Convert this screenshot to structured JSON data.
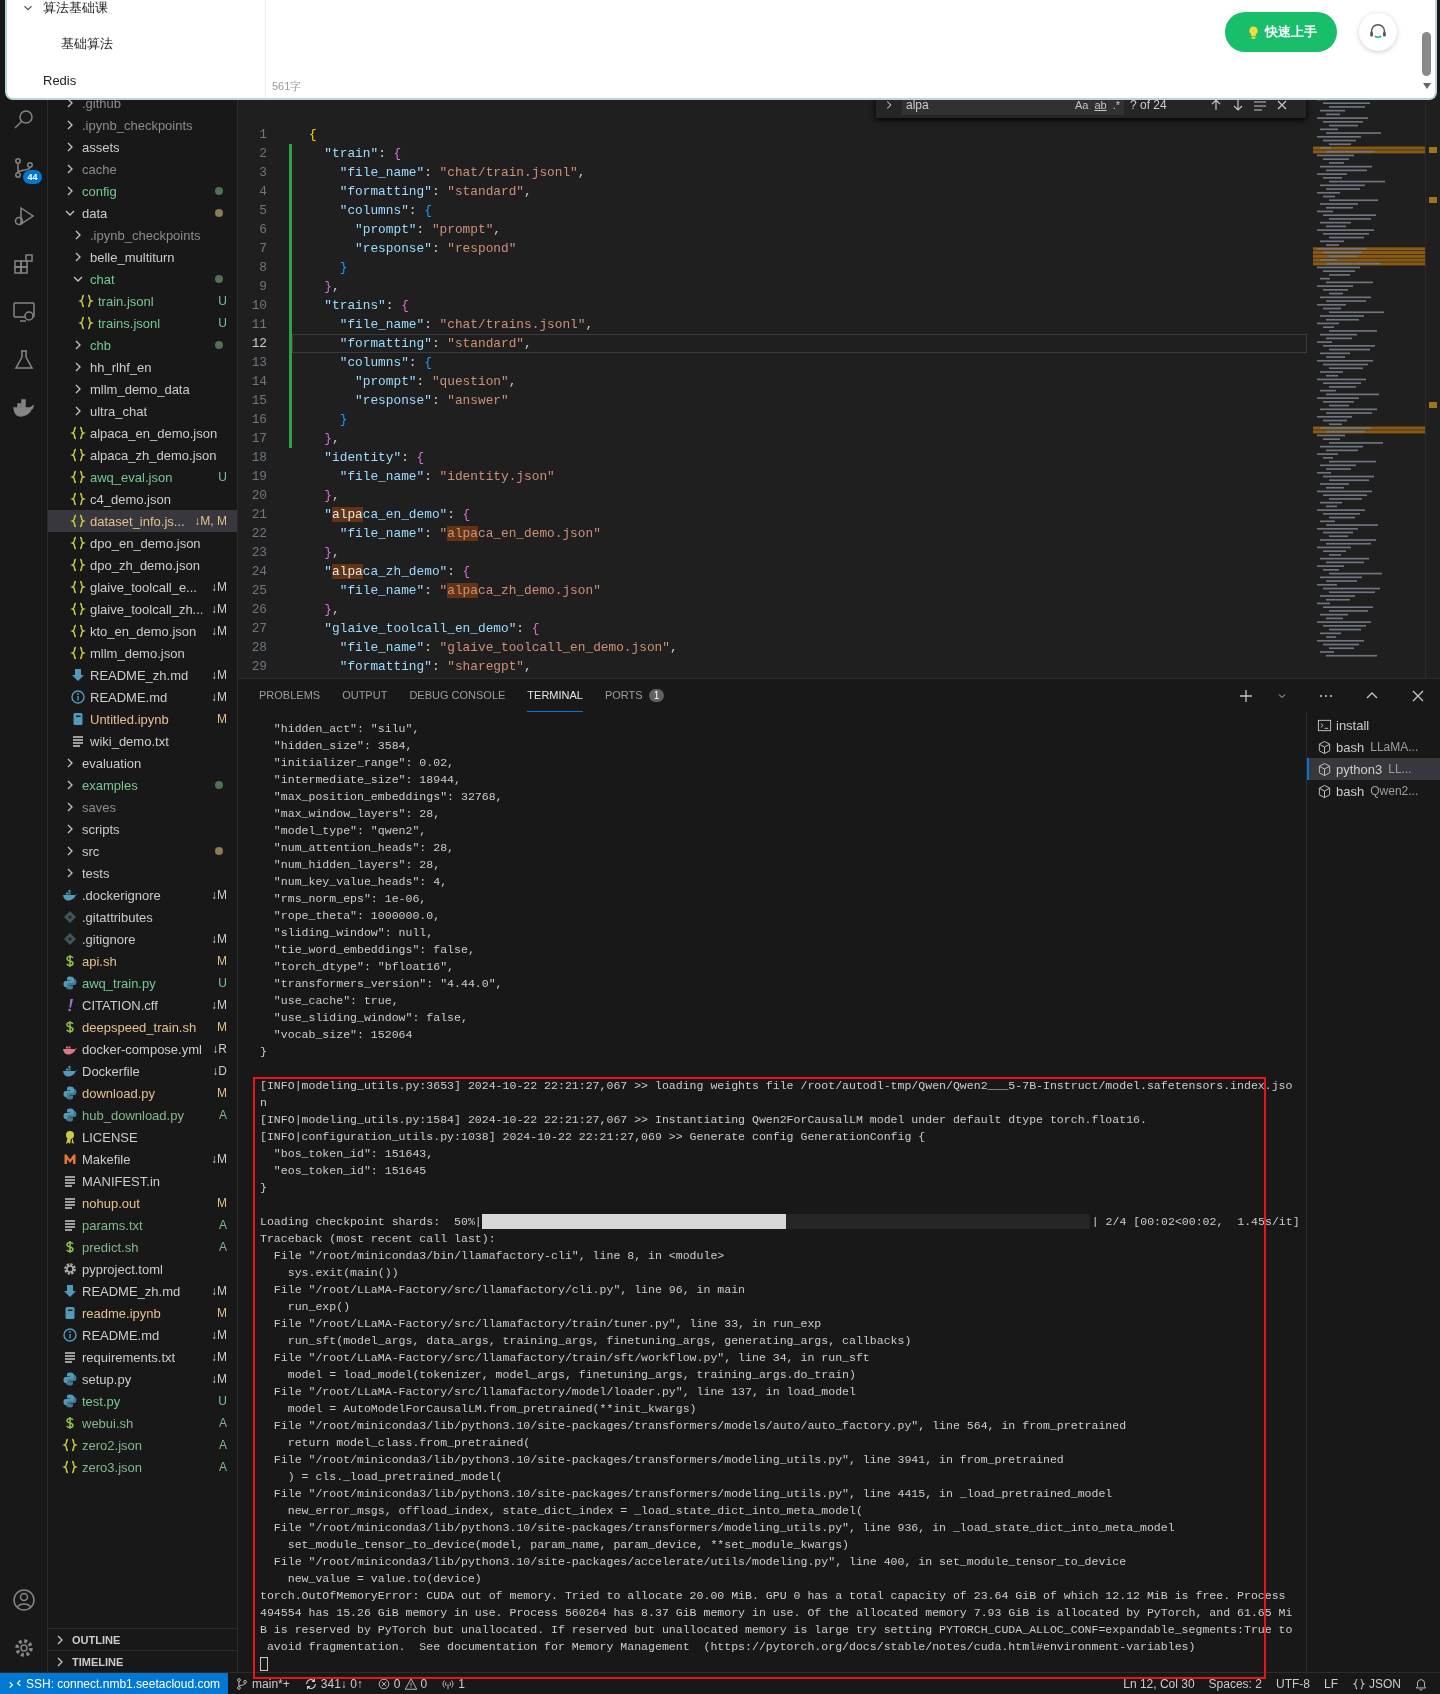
{
  "note_popup": {
    "tree": [
      {
        "label": "算法基础课",
        "expanded": true,
        "children": [
          {
            "label": "基础算法"
          }
        ]
      },
      {
        "label": "Redis"
      }
    ],
    "word_count": "561字",
    "quick_start_button": "快速上手"
  },
  "activity_bar": {
    "top": [
      {
        "kind": "search"
      },
      {
        "kind": "scm",
        "badge": "44"
      },
      {
        "kind": "debug"
      },
      {
        "kind": "extensions"
      },
      {
        "kind": "remote"
      },
      {
        "kind": "testing"
      },
      {
        "kind": "docker"
      }
    ],
    "bottom": [
      {
        "kind": "account"
      },
      {
        "kind": "settings"
      }
    ]
  },
  "explorer": {
    "items": [
      {
        "label": ".github",
        "kind": "folder",
        "expanded": false,
        "color": "#8c8c8c",
        "selected": false
      },
      {
        "label": ".ipynb_checkpoints",
        "kind": "folder",
        "expanded": false,
        "color": "#8c8c8c",
        "selected": false
      },
      {
        "label": "assets",
        "kind": "folder",
        "expanded": false,
        "color": "#cccccc",
        "selected": false
      },
      {
        "label": "cache",
        "kind": "folder",
        "expanded": false,
        "color": "#8c8c8c",
        "selected": false
      },
      {
        "label": "config",
        "kind": "folder",
        "expanded": false,
        "color": "#73c991",
        "dot": {
          "color": "#4f7255"
        },
        "selected": false
      },
      {
        "label": "data",
        "kind": "folder",
        "expanded": true,
        "color": "#cccccc",
        "dot": {
          "color": "#8c7a58"
        },
        "selected": false,
        "children": [
          {
            "label": ".ipynb_checkpoints",
            "kind": "folder",
            "expanded": false,
            "color": "#8c8c8c",
            "selected": false
          },
          {
            "label": "belle_multiturn",
            "kind": "folder",
            "expanded": false,
            "color": "#cccccc",
            "selected": false
          },
          {
            "label": "chat",
            "kind": "folder",
            "expanded": true,
            "color": "#73c991",
            "dot": {
              "color": "#4f7255"
            },
            "selected": false,
            "children": [
              {
                "label": "train.jsonl",
                "kind": "json",
                "color": "#73c991",
                "badge": "U",
                "selected": false
              },
              {
                "label": "trains.jsonl",
                "kind": "json",
                "color": "#73c991",
                "badge": "U",
                "selected": false
              }
            ]
          },
          {
            "label": "chb",
            "kind": "folder",
            "expanded": false,
            "color": "#73c991",
            "dot": {
              "color": "#4f7255"
            },
            "selected": false
          },
          {
            "label": "hh_rlhf_en",
            "kind": "folder",
            "expanded": false,
            "color": "#cccccc",
            "selected": false
          },
          {
            "label": "mllm_demo_data",
            "kind": "folder",
            "expanded": false,
            "color": "#cccccc",
            "selected": false
          },
          {
            "label": "ultra_chat",
            "kind": "folder",
            "expanded": false,
            "color": "#cccccc",
            "selected": false
          },
          {
            "label": "alpaca_en_demo.json",
            "kind": "json",
            "color": "#cccccc",
            "selected": false
          },
          {
            "label": "alpaca_zh_demo.json",
            "kind": "json",
            "color": "#cccccc",
            "selected": false
          },
          {
            "label": "awq_eval.json",
            "kind": "json",
            "color": "#73c991",
            "badge": "U",
            "selected": false
          },
          {
            "label": "c4_demo.json",
            "kind": "json",
            "color": "#cccccc",
            "selected": false
          },
          {
            "label": "dataset_info.js...",
            "kind": "json",
            "color": "#e2c08d",
            "badge": "↓M, M",
            "selected": true
          },
          {
            "label": "dpo_en_demo.json",
            "kind": "json",
            "color": "#cccccc",
            "selected": false
          },
          {
            "label": "dpo_zh_demo.json",
            "kind": "json",
            "color": "#cccccc",
            "selected": false
          },
          {
            "label": "glaive_toolcall_e...",
            "kind": "json",
            "color": "#cccccc",
            "badge": "↓M",
            "selected": false
          },
          {
            "label": "glaive_toolcall_zh...",
            "kind": "json",
            "color": "#cccccc",
            "badge": "↓M",
            "selected": false
          },
          {
            "label": "kto_en_demo.json",
            "kind": "json",
            "color": "#cccccc",
            "badge": "↓M",
            "selected": false
          },
          {
            "label": "mllm_demo.json",
            "kind": "json",
            "color": "#cccccc",
            "selected": false
          },
          {
            "label": "README_zh.md",
            "kind": "download",
            "color": "#cccccc",
            "badge": "↓M",
            "selected": false
          },
          {
            "label": "README.md",
            "kind": "info",
            "color": "#cccccc",
            "badge": "↓M",
            "selected": false
          },
          {
            "label": "Untitled.ipynb",
            "kind": "notebook",
            "color": "#e2c08d",
            "badge": "M",
            "selected": false
          },
          {
            "label": "wiki_demo.txt",
            "kind": "text",
            "color": "#cccccc",
            "selected": false
          }
        ]
      },
      {
        "label": "evaluation",
        "kind": "folder",
        "expanded": false,
        "color": "#cccccc",
        "selected": false
      },
      {
        "label": "examples",
        "kind": "folder",
        "expanded": false,
        "color": "#73c991",
        "dot": {
          "color": "#4f7255"
        },
        "selected": false
      },
      {
        "label": "saves",
        "kind": "folder",
        "expanded": false,
        "color": "#8c8c8c",
        "selected": false
      },
      {
        "label": "scripts",
        "kind": "folder",
        "expanded": false,
        "color": "#cccccc",
        "selected": false
      },
      {
        "label": "src",
        "kind": "folder",
        "expanded": false,
        "color": "#cccccc",
        "dot": {
          "color": "#8c7a58"
        },
        "selected": false
      },
      {
        "label": "tests",
        "kind": "folder",
        "expanded": false,
        "color": "#cccccc",
        "selected": false
      },
      {
        "label": ".dockerignore",
        "kind": "docker",
        "color": "#cccccc",
        "badge": "↓M",
        "selected": false
      },
      {
        "label": ".gitattributes",
        "kind": "git",
        "color": "#cccccc",
        "selected": false
      },
      {
        "label": ".gitignore",
        "kind": "git",
        "color": "#cccccc",
        "badge": "↓M",
        "selected": false
      },
      {
        "label": "api.sh",
        "kind": "shell",
        "color": "#e2c08d",
        "badge": "M",
        "selected": false
      },
      {
        "label": "awq_train.py",
        "kind": "python",
        "color": "#73c991",
        "badge": "U",
        "selected": false
      },
      {
        "label": "CITATION.cff",
        "kind": "exclaim",
        "color": "#cccccc",
        "badge": "↓M",
        "selected": false
      },
      {
        "label": "deepspeed_train.sh",
        "kind": "shell",
        "color": "#e2c08d",
        "badge": "M",
        "selected": false
      },
      {
        "label": "docker-compose.yml",
        "kind": "compose",
        "color": "#cccccc",
        "badge": "↓R",
        "selected": false
      },
      {
        "label": "Dockerfile",
        "kind": "docker",
        "color": "#cccccc",
        "badge": "↓D",
        "selected": false
      },
      {
        "label": "download.py",
        "kind": "python",
        "color": "#e2c08d",
        "badge": "M",
        "selected": false
      },
      {
        "label": "hub_download.py",
        "kind": "python",
        "color": "#81b88b",
        "badge": "A",
        "selected": false
      },
      {
        "label": "LICENSE",
        "kind": "license",
        "color": "#cccccc",
        "selected": false
      },
      {
        "label": "Makefile",
        "kind": "makefile",
        "color": "#cccccc",
        "badge": "↓M",
        "selected": false
      },
      {
        "label": "MANIFEST.in",
        "kind": "text",
        "color": "#cccccc",
        "selected": false
      },
      {
        "label": "nohup.out",
        "kind": "text",
        "color": "#e2c08d",
        "badge": "M",
        "selected": false
      },
      {
        "label": "params.txt",
        "kind": "text",
        "color": "#81b88b",
        "badge": "A",
        "selected": false
      },
      {
        "label": "predict.sh",
        "kind": "shell",
        "color": "#81b88b",
        "badge": "A",
        "selected": false
      },
      {
        "label": "pyproject.toml",
        "kind": "gear",
        "color": "#cccccc",
        "selected": false
      },
      {
        "label": "README_zh.md",
        "kind": "download",
        "color": "#cccccc",
        "badge": "↓M",
        "selected": false
      },
      {
        "label": "readme.ipynb",
        "kind": "notebook",
        "color": "#e2c08d",
        "badge": "M",
        "selected": false
      },
      {
        "label": "README.md",
        "kind": "info",
        "color": "#cccccc",
        "badge": "↓M",
        "selected": false
      },
      {
        "label": "requirements.txt",
        "kind": "text",
        "color": "#cccccc",
        "badge": "↓M",
        "selected": false
      },
      {
        "label": "setup.py",
        "kind": "python",
        "color": "#cccccc",
        "badge": "↓M",
        "selected": false
      },
      {
        "label": "test.py",
        "kind": "python",
        "color": "#73c991",
        "badge": "U",
        "selected": false
      },
      {
        "label": "webui.sh",
        "kind": "shell",
        "color": "#81b88b",
        "badge": "A",
        "selected": false
      },
      {
        "label": "zero2.json",
        "kind": "json",
        "color": "#81b88b",
        "badge": "A",
        "selected": false
      },
      {
        "label": "zero3.json",
        "kind": "json",
        "color": "#81b88b",
        "badge": "A",
        "selected": false
      }
    ],
    "sections": [
      {
        "label": "OUTLINE",
        "expanded": false
      },
      {
        "label": "TIMELINE",
        "expanded": false
      }
    ]
  },
  "find_widget": {
    "value": "alpa",
    "options": [
      "Aa",
      "ab",
      ".*"
    ],
    "result": "? of 24"
  },
  "editor": {
    "lines": [
      {
        "number": "1",
        "added": false,
        "current": false,
        "tokens": [
          {
            "text": "{",
            "kind": "b1"
          }
        ]
      },
      {
        "number": "2",
        "added": true,
        "current": false,
        "tokens": [
          {
            "text": "  \"train\"",
            "kind": "k"
          },
          {
            "text": ": ",
            "kind": "p"
          },
          {
            "text": "{",
            "kind": "b2"
          }
        ]
      },
      {
        "number": "3",
        "added": true,
        "current": false,
        "tokens": [
          {
            "text": "    \"file_name\"",
            "kind": "k"
          },
          {
            "text": ": ",
            "kind": "p"
          },
          {
            "text": "\"chat/train.jsonl\"",
            "kind": "s"
          },
          {
            "text": ",",
            "kind": "p"
          }
        ]
      },
      {
        "number": "4",
        "added": true,
        "current": false,
        "tokens": [
          {
            "text": "    \"formatting\"",
            "kind": "k"
          },
          {
            "text": ": ",
            "kind": "p"
          },
          {
            "text": "\"standard\"",
            "kind": "s"
          },
          {
            "text": ",",
            "kind": "p"
          }
        ]
      },
      {
        "number": "5",
        "added": true,
        "current": false,
        "tokens": [
          {
            "text": "    \"columns\"",
            "kind": "k"
          },
          {
            "text": ": ",
            "kind": "p"
          },
          {
            "text": "{",
            "kind": "b3"
          }
        ]
      },
      {
        "number": "6",
        "added": true,
        "current": false,
        "tokens": [
          {
            "text": "      \"prompt\"",
            "kind": "k"
          },
          {
            "text": ": ",
            "kind": "p"
          },
          {
            "text": "\"prompt\"",
            "kind": "s"
          },
          {
            "text": ",",
            "kind": "p"
          }
        ]
      },
      {
        "number": "7",
        "added": true,
        "current": false,
        "tokens": [
          {
            "text": "      \"response\"",
            "kind": "k"
          },
          {
            "text": ": ",
            "kind": "p"
          },
          {
            "text": "\"respond\"",
            "kind": "s"
          }
        ]
      },
      {
        "number": "8",
        "added": true,
        "current": false,
        "tokens": [
          {
            "text": "    }",
            "kind": "b3"
          }
        ]
      },
      {
        "number": "9",
        "added": true,
        "current": false,
        "tokens": [
          {
            "text": "  }",
            "kind": "b2"
          },
          {
            "text": ",",
            "kind": "p"
          }
        ]
      },
      {
        "number": "10",
        "added": true,
        "current": false,
        "tokens": [
          {
            "text": "  \"trains\"",
            "kind": "k"
          },
          {
            "text": ": ",
            "kind": "p"
          },
          {
            "text": "{",
            "kind": "b2"
          }
        ]
      },
      {
        "number": "11",
        "added": true,
        "current": false,
        "tokens": [
          {
            "text": "    \"file_name\"",
            "kind": "k"
          },
          {
            "text": ": ",
            "kind": "p"
          },
          {
            "text": "\"chat/trains.jsonl\"",
            "kind": "s"
          },
          {
            "text": ",",
            "kind": "p"
          }
        ]
      },
      {
        "number": "12",
        "added": true,
        "current": true,
        "tokens": [
          {
            "text": "    \"formatting\"",
            "kind": "k"
          },
          {
            "text": ": ",
            "kind": "p"
          },
          {
            "text": "\"standard\"",
            "kind": "s"
          },
          {
            "text": ",",
            "kind": "p"
          }
        ]
      },
      {
        "number": "13",
        "added": true,
        "current": false,
        "tokens": [
          {
            "text": "    \"columns\"",
            "kind": "k"
          },
          {
            "text": ": ",
            "kind": "p"
          },
          {
            "text": "{",
            "kind": "b3"
          }
        ]
      },
      {
        "number": "14",
        "added": true,
        "current": false,
        "tokens": [
          {
            "text": "      \"prompt\"",
            "kind": "k"
          },
          {
            "text": ": ",
            "kind": "p"
          },
          {
            "text": "\"question\"",
            "kind": "s"
          },
          {
            "text": ",",
            "kind": "p"
          }
        ]
      },
      {
        "number": "15",
        "added": true,
        "current": false,
        "tokens": [
          {
            "text": "      \"response\"",
            "kind": "k"
          },
          {
            "text": ": ",
            "kind": "p"
          },
          {
            "text": "\"answer\"",
            "kind": "s"
          }
        ]
      },
      {
        "number": "16",
        "added": true,
        "current": false,
        "tokens": [
          {
            "text": "    }",
            "kind": "b3"
          }
        ]
      },
      {
        "number": "17",
        "added": true,
        "current": false,
        "tokens": [
          {
            "text": "  }",
            "kind": "b2"
          },
          {
            "text": ",",
            "kind": "p"
          }
        ]
      },
      {
        "number": "18",
        "added": false,
        "current": false,
        "tokens": [
          {
            "text": "  \"identity\"",
            "kind": "k"
          },
          {
            "text": ": ",
            "kind": "p"
          },
          {
            "text": "{",
            "kind": "b2"
          }
        ]
      },
      {
        "number": "19",
        "added": false,
        "current": false,
        "tokens": [
          {
            "text": "    \"file_name\"",
            "kind": "k"
          },
          {
            "text": ": ",
            "kind": "p"
          },
          {
            "text": "\"identity.json\"",
            "kind": "s"
          }
        ]
      },
      {
        "number": "20",
        "added": false,
        "current": false,
        "tokens": [
          {
            "text": "  }",
            "kind": "b2"
          },
          {
            "text": ",",
            "kind": "p"
          }
        ]
      },
      {
        "number": "21",
        "added": false,
        "current": false,
        "tokens": [
          {
            "text": "  \"",
            "kind": "k"
          },
          {
            "text": "alpa",
            "kind": "mk"
          },
          {
            "text": "ca_en_demo\"",
            "kind": "k"
          },
          {
            "text": ": ",
            "kind": "p"
          },
          {
            "text": "{",
            "kind": "b2"
          }
        ]
      },
      {
        "number": "22",
        "added": false,
        "current": false,
        "tokens": [
          {
            "text": "    \"file_name\"",
            "kind": "k"
          },
          {
            "text": ": ",
            "kind": "p"
          },
          {
            "text": "\"",
            "kind": "s"
          },
          {
            "text": "alpa",
            "kind": "ms"
          },
          {
            "text": "ca_en_demo.json\"",
            "kind": "s"
          }
        ]
      },
      {
        "number": "23",
        "added": false,
        "current": false,
        "tokens": [
          {
            "text": "  }",
            "kind": "b2"
          },
          {
            "text": ",",
            "kind": "p"
          }
        ]
      },
      {
        "number": "24",
        "added": false,
        "current": false,
        "tokens": [
          {
            "text": "  \"",
            "kind": "k"
          },
          {
            "text": "alpa",
            "kind": "mk"
          },
          {
            "text": "ca_zh_demo\"",
            "kind": "k"
          },
          {
            "text": ": ",
            "kind": "p"
          },
          {
            "text": "{",
            "kind": "b2"
          }
        ]
      },
      {
        "number": "25",
        "added": false,
        "current": false,
        "tokens": [
          {
            "text": "    \"file_name\"",
            "kind": "k"
          },
          {
            "text": ": ",
            "kind": "p"
          },
          {
            "text": "\"",
            "kind": "s"
          },
          {
            "text": "alpa",
            "kind": "ms"
          },
          {
            "text": "ca_zh_demo.json\"",
            "kind": "s"
          }
        ]
      },
      {
        "number": "26",
        "added": false,
        "current": false,
        "tokens": [
          {
            "text": "  }",
            "kind": "b2"
          },
          {
            "text": ",",
            "kind": "p"
          }
        ]
      },
      {
        "number": "27",
        "added": false,
        "current": false,
        "tokens": [
          {
            "text": "  \"glaive_toolcall_en_demo\"",
            "kind": "k"
          },
          {
            "text": ": ",
            "kind": "p"
          },
          {
            "text": "{",
            "kind": "b2"
          }
        ]
      },
      {
        "number": "28",
        "added": false,
        "current": false,
        "tokens": [
          {
            "text": "    \"file_name\"",
            "kind": "k"
          },
          {
            "text": ": ",
            "kind": "p"
          },
          {
            "text": "\"glaive_toolcall_en_demo.json\"",
            "kind": "s"
          },
          {
            "text": ",",
            "kind": "p"
          }
        ]
      },
      {
        "number": "29",
        "added": false,
        "current": false,
        "tokens": [
          {
            "text": "    \"formatting\"",
            "kind": "k"
          },
          {
            "text": ": ",
            "kind": "p"
          },
          {
            "text": "\"sharegpt\"",
            "kind": "s"
          },
          {
            "text": ",",
            "kind": "p"
          }
        ]
      }
    ]
  },
  "panel": {
    "tabs": [
      {
        "label": "PROBLEMS",
        "selected": false
      },
      {
        "label": "OUTPUT",
        "selected": false
      },
      {
        "label": "DEBUG CONSOLE",
        "selected": false
      },
      {
        "label": "TERMINAL",
        "selected": true
      },
      {
        "label": "PORTS",
        "selected": false,
        "badge": "1"
      }
    ],
    "terminal": {
      "lines": [
        "  \"hidden_act\": \"silu\",",
        "  \"hidden_size\": 3584,",
        "  \"initializer_range\": 0.02,",
        "  \"intermediate_size\": 18944,",
        "  \"max_position_embeddings\": 32768,",
        "  \"max_window_layers\": 28,",
        "  \"model_type\": \"qwen2\",",
        "  \"num_attention_heads\": 28,",
        "  \"num_hidden_layers\": 28,",
        "  \"num_key_value_heads\": 4,",
        "  \"rms_norm_eps\": 1e-06,",
        "  \"rope_theta\": 1000000.0,",
        "  \"sliding_window\": null,",
        "  \"tie_word_embeddings\": false,",
        "  \"torch_dtype\": \"bfloat16\",",
        "  \"transformers_version\": \"4.44.0\",",
        "  \"use_cache\": true,",
        "  \"use_sliding_window\": false,",
        "  \"vocab_size\": 152064",
        "}"
      ],
      "framed_lines": [
        "[INFO|modeling_utils.py:3653] 2024-10-22 22:21:27,067 >> loading weights file /root/autodl-tmp/Qwen/Qwen2___5-7B-Instruct/model.safetensors.index.jso",
        "n",
        "[INFO|modeling_utils.py:1584] 2024-10-22 22:21:27,067 >> Instantiating Qwen2ForCausalLM model under default dtype torch.float16.",
        "[INFO|configuration_utils.py:1038] 2024-10-22 22:21:27,069 >> Generate config GenerationConfig {",
        "  \"bos_token_id\": 151643,",
        "  \"eos_token_id\": 151645",
        "}"
      ],
      "progress": {
        "label": "Loading checkpoint shards:  50%|",
        "level": 0.5,
        "reading": "| 2/4 [00:02<00:02,  1.45s/it]"
      },
      "traceback_lines": [
        "Traceback (most recent call last):",
        "  File \"/root/miniconda3/bin/llamafactory-cli\", line 8, in <module>",
        "    sys.exit(main())",
        "  File \"/root/LLaMA-Factory/src/llamafactory/cli.py\", line 96, in main",
        "    run_exp()",
        "  File \"/root/LLaMA-Factory/src/llamafactory/train/tuner.py\", line 33, in run_exp",
        "    run_sft(model_args, data_args, training_args, finetuning_args, generating_args, callbacks)",
        "  File \"/root/LLaMA-Factory/src/llamafactory/train/sft/workflow.py\", line 34, in run_sft",
        "    model = load_model(tokenizer, model_args, finetuning_args, training_args.do_train)",
        "  File \"/root/LLaMA-Factory/src/llamafactory/model/loader.py\", line 137, in load_model",
        "    model = AutoModelForCausalLM.from_pretrained(**init_kwargs)",
        "  File \"/root/miniconda3/lib/python3.10/site-packages/transformers/models/auto/auto_factory.py\", line 564, in from_pretrained",
        "    return model_class.from_pretrained(",
        "  File \"/root/miniconda3/lib/python3.10/site-packages/transformers/modeling_utils.py\", line 3941, in from_pretrained",
        "    ) = cls._load_pretrained_model(",
        "  File \"/root/miniconda3/lib/python3.10/site-packages/transformers/modeling_utils.py\", line 4415, in _load_pretrained_model",
        "    new_error_msgs, offload_index, state_dict_index = _load_state_dict_into_meta_model(",
        "  File \"/root/miniconda3/lib/python3.10/site-packages/transformers/modeling_utils.py\", line 936, in _load_state_dict_into_meta_model",
        "    set_module_tensor_to_device(model, param_name, param_device, **set_module_kwargs)",
        "  File \"/root/miniconda3/lib/python3.10/site-packages/accelerate/utils/modeling.py\", line 400, in set_module_tensor_to_device",
        "    new_value = value.to(device)",
        "torch.OutOfMemoryError: CUDA out of memory. Tried to allocate 20.00 MiB. GPU 0 has a total capacity of 23.64 GiB of which 12.12 MiB is free. Process",
        "494554 has 15.26 GiB memory in use. Process 560264 has 8.37 GiB memory in use. Of the allocated memory 7.93 GiB is allocated by PyTorch, and 61.65 Mi",
        "B is reserved by PyTorch but unallocated. If reserved but unallocated memory is large try setting PYTORCH_CUDA_ALLOC_CONF=expandable_segments:True to",
        " avoid fragmentation.  See documentation for Memory Management  (https://pytorch.org/docs/stable/notes/cuda.html#environment-variables)"
      ],
      "cursor": true
    },
    "terminals": [
      {
        "kind": "task",
        "name": "install",
        "selected": false
      },
      {
        "kind": "shell",
        "name": "bash",
        "detail": "LLaMA...",
        "selected": false
      },
      {
        "kind": "shell",
        "name": "python3",
        "detail": "LL...",
        "selected": true
      },
      {
        "kind": "shell",
        "name": "bash",
        "detail": "Qwen2...",
        "selected": false
      }
    ]
  },
  "status_bar": {
    "remote": "SSH: connect.nmb1.seetacloud.com",
    "branch": "main*+",
    "sync": "341↓ 0↑",
    "errors": "0",
    "warnings": "0",
    "ports": "1",
    "right": [
      {
        "kind": "text",
        "text": "Ln 12, Col 30"
      },
      {
        "kind": "text",
        "text": "Spaces: 2"
      },
      {
        "kind": "text",
        "text": "UTF-8"
      },
      {
        "kind": "text",
        "text": "LF"
      },
      {
        "kind": "language",
        "text": "JSON"
      }
    ]
  }
}
